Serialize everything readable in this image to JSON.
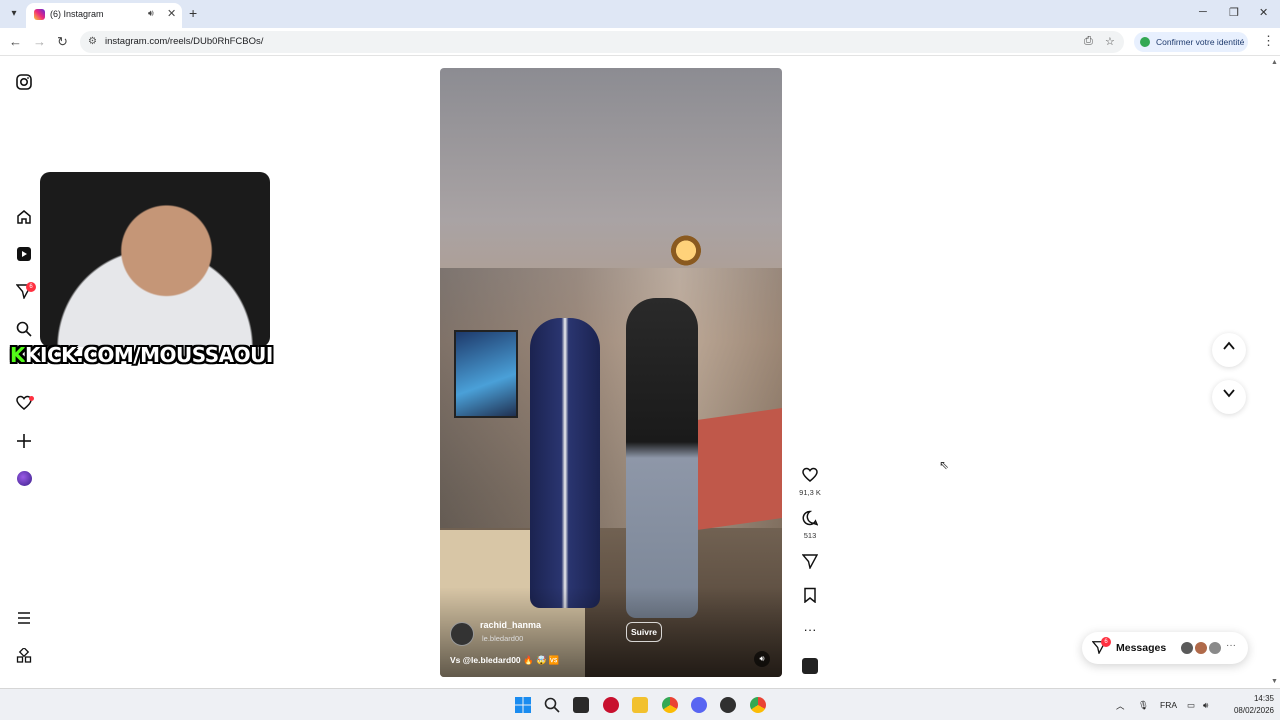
{
  "browser": {
    "tab_title": "(6) Instagram",
    "url": "instagram.com/reels/DUb0RhFCBOs/",
    "identity_button": "Confirmer votre identité"
  },
  "instagram": {
    "nav_badge_count": "6",
    "overlay_text_k": "K",
    "overlay_text_rest": "KICK.COM/MOUSSAOUI"
  },
  "reel": {
    "username": "rachid_hanma",
    "subname": "le.bledard00",
    "follow_label": "Suivre",
    "caption": "Vs @le.bledard00 🔥 🤯 🆚",
    "likes": "91,3 K",
    "comments": "513"
  },
  "messages": {
    "label": "Messages",
    "badge": "6"
  },
  "taskbar": {
    "language": "FRA",
    "time": "14:35",
    "date": "08/02/2026"
  },
  "colors": {
    "brand_red": "#ff3040",
    "kick_green": "#53fc18",
    "chrome_blue": "#dfe7f5"
  }
}
